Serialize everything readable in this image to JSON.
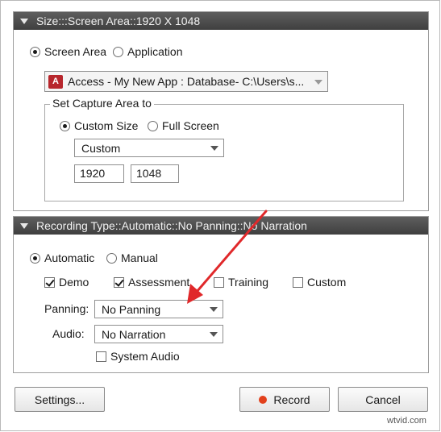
{
  "size_panel": {
    "title": "Size:::Screen Area::1920 X 1048",
    "mode_options": [
      {
        "label": "Screen Area",
        "selected": true
      },
      {
        "label": "Application",
        "selected": false
      }
    ],
    "app_select": {
      "value": "Access - My New App : Database- C:\\Users\\s...",
      "icon": "access-app-icon"
    },
    "capture_group": {
      "legend": "Set Capture Area to",
      "options": [
        {
          "label": "Custom Size",
          "selected": true
        },
        {
          "label": "Full Screen",
          "selected": false
        }
      ],
      "preset_select": "Custom",
      "width": "1920",
      "height": "1048"
    }
  },
  "recording_panel": {
    "title": "Recording Type::Automatic::No Panning::No Narration",
    "mode_options": [
      {
        "label": "Automatic",
        "selected": true
      },
      {
        "label": "Manual",
        "selected": false
      }
    ],
    "types": [
      {
        "label": "Demo",
        "checked": true
      },
      {
        "label": "Assessment",
        "checked": true
      },
      {
        "label": "Training",
        "checked": false
      },
      {
        "label": "Custom",
        "checked": false
      }
    ],
    "panning_label": "Panning:",
    "panning_value": "No Panning",
    "audio_label": "Audio:",
    "audio_value": "No Narration",
    "system_audio": {
      "label": "System Audio",
      "checked": false
    }
  },
  "buttons": {
    "settings": "Settings...",
    "record": "Record",
    "cancel": "Cancel"
  },
  "colors": {
    "arrow": "#e0282a",
    "record_dot": "#e2401c",
    "header_bg": "#4a4a4a"
  },
  "watermark": "wtvid.com"
}
